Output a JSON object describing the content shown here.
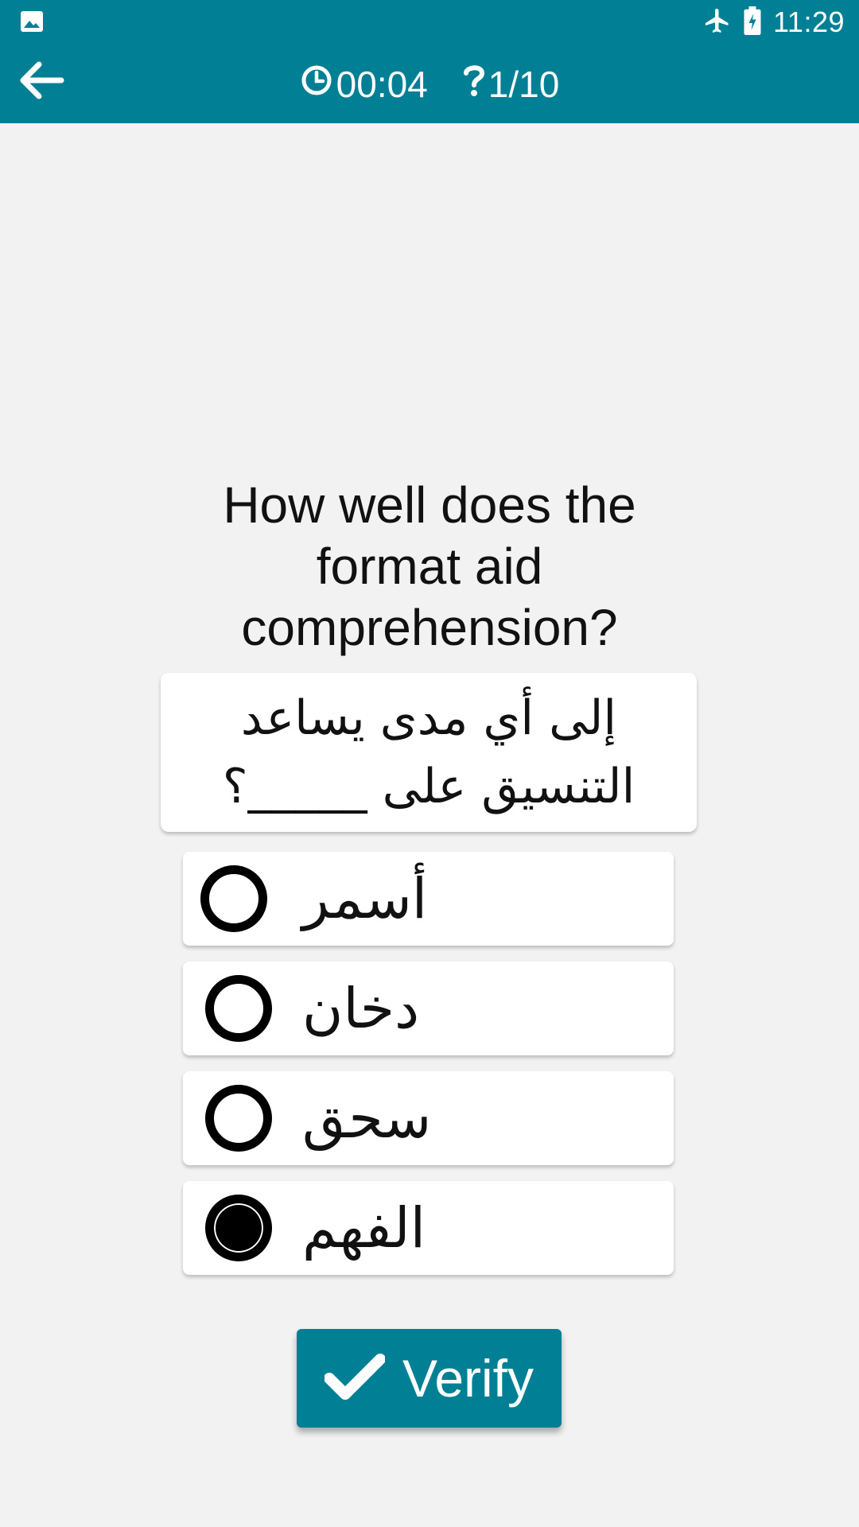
{
  "status_bar": {
    "time": "11:29",
    "icons": [
      "image-notification-icon",
      "airplane-mode-icon",
      "battery-charging-icon"
    ]
  },
  "toolbar": {
    "back_icon": "arrow-left-icon",
    "timer_icon": "clock-icon",
    "timer": "00:04",
    "progress_icon": "question-mark-icon",
    "progress": "1/10"
  },
  "question": {
    "english": "How well does the format aid comprehension?",
    "arabic": "إلى أي مدى يساعد التنسيق على _____؟"
  },
  "options": [
    {
      "label": "أسمر",
      "selected": false
    },
    {
      "label": "دخان",
      "selected": false
    },
    {
      "label": "سحق",
      "selected": false
    },
    {
      "label": "الفهم",
      "selected": true
    }
  ],
  "verify_button": {
    "icon": "checkmark-icon",
    "label": "Verify"
  },
  "colors": {
    "primary": "#007f95",
    "background": "#f2f2f2",
    "card": "#ffffff"
  }
}
